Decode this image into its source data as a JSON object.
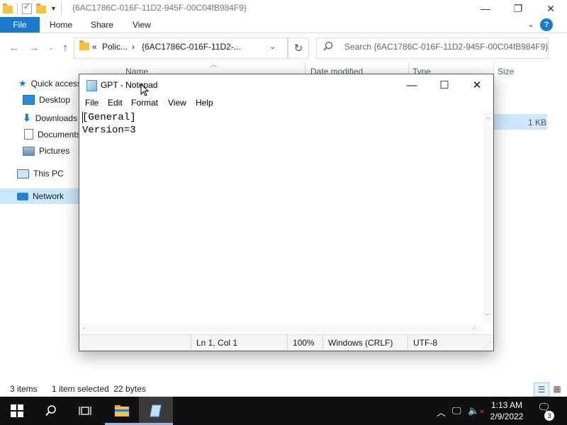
{
  "explorer": {
    "title": "{6AC1786C-016F-11D2-945F-00C04fB984F9}",
    "ribbon": {
      "file": "File",
      "tabs": [
        "Home",
        "Share",
        "View"
      ],
      "help": "?"
    },
    "address": {
      "chevron": "«",
      "part1": "Polic...",
      "sep": "›",
      "part2": "{6AC1786C-016F-11D2-..."
    },
    "search_placeholder": "Search {6AC1786C-016F-11D2-945F-00C04fB984F9}",
    "columns": {
      "name": "Name",
      "date_modified": "Date modified",
      "type": "Type",
      "size": "Size"
    },
    "file_size": "1 KB",
    "nav": {
      "quick_access": "Quick access",
      "desktop": "Desktop",
      "downloads": "Downloads",
      "documents": "Documents",
      "pictures": "Pictures",
      "this_pc": "This PC",
      "network": "Network"
    },
    "status": {
      "items": "3 items",
      "selected": "1 item selected  22 bytes"
    }
  },
  "notepad": {
    "title": "GPT - Notepad",
    "menu": [
      "File",
      "Edit",
      "Format",
      "View",
      "Help"
    ],
    "content": "[General]\nVersion=3",
    "status": {
      "position": "Ln 1, Col 1",
      "zoom": "100%",
      "line_ending": "Windows (CRLF)",
      "encoding": "UTF-8"
    }
  },
  "taskbar": {
    "time": "1:13 AM",
    "date": "2/9/2022",
    "notification_count": "3"
  }
}
